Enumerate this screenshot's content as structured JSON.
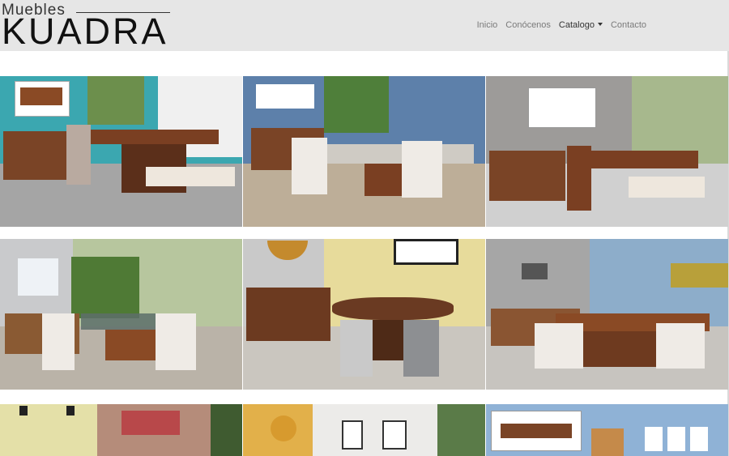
{
  "brand": {
    "small": "Muebles",
    "big": "KUADRA"
  },
  "nav": {
    "items": [
      {
        "label": "Inicio",
        "active": false
      },
      {
        "label": "Conócenos",
        "active": false
      },
      {
        "label": "Catalogo",
        "active": true,
        "dropdown": true
      },
      {
        "label": "Contacto",
        "active": false
      }
    ]
  },
  "catalog": {
    "tiles": [
      {
        "name": "dining-set-1",
        "wall": "#3aa7b0",
        "floor": "#9a9a9a"
      },
      {
        "name": "dining-set-2",
        "wall": "#5d7fa8",
        "floor": "#b9ab95"
      },
      {
        "name": "dining-set-3",
        "wall": "#9c9a98",
        "floor": "#cfcfcf"
      },
      {
        "name": "dining-set-4",
        "wall": "#b9c7a0",
        "floor": "#b8b1a6"
      },
      {
        "name": "dining-set-5",
        "wall": "#e6d99a",
        "floor": "#c9c5be"
      },
      {
        "name": "dining-set-6",
        "wall": "#8eaecb",
        "floor": "#c6c3be"
      },
      {
        "name": "dining-set-7",
        "wall": "#e5e0a8",
        "floor": "#c0b8ab"
      },
      {
        "name": "dining-set-8",
        "wall": "#ebe7e1",
        "floor": "#c7c2ba"
      },
      {
        "name": "dining-set-9",
        "wall": "#8fb2d6",
        "floor": "#cac6c0"
      }
    ]
  }
}
